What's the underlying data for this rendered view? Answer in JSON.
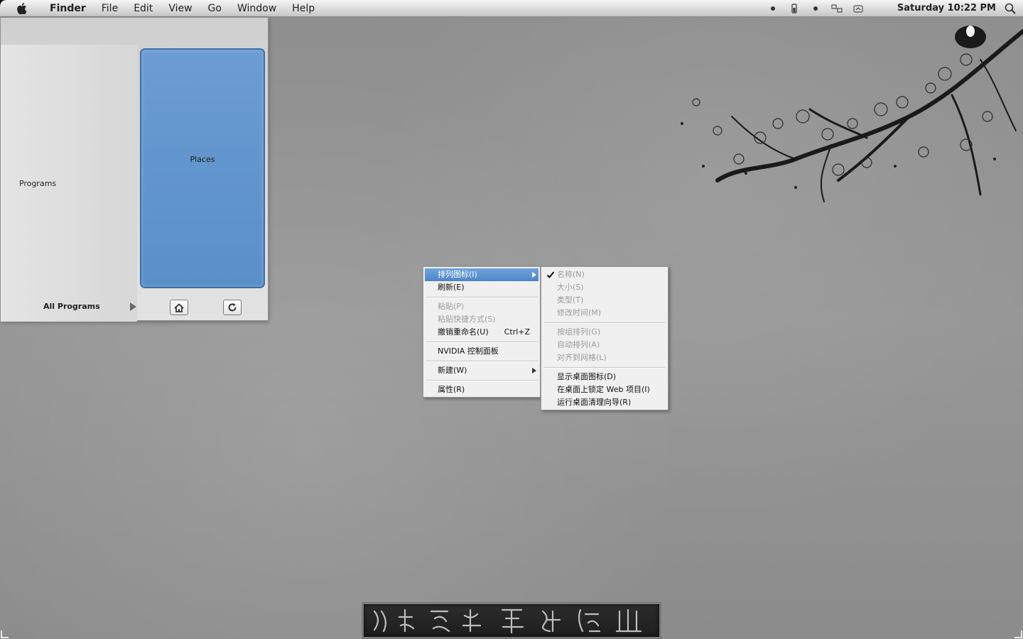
{
  "menubar": {
    "app_name": "Finder",
    "items": [
      "File",
      "Edit",
      "View",
      "Go",
      "Window",
      "Help"
    ],
    "clock": "Saturday 10:22 PM"
  },
  "start_panel": {
    "programs_label": "Programs",
    "all_programs_label": "All Programs",
    "places_label": "Places"
  },
  "context_menu": {
    "items": [
      {
        "label": "排列图标(I)"
      },
      {
        "label": "刷新(E)"
      },
      {
        "label": "粘贴(P)"
      },
      {
        "label": "粘贴快捷方式(S)"
      },
      {
        "label": "撤销重命名(U)",
        "shortcut": "Ctrl+Z"
      },
      {
        "label": "NVIDIA 控制面板"
      },
      {
        "label": "新建(W)"
      },
      {
        "label": "属性(R)"
      }
    ]
  },
  "submenu": {
    "items": [
      {
        "label": "名称(N)"
      },
      {
        "label": "大小(S)"
      },
      {
        "label": "类型(T)"
      },
      {
        "label": "修改时间(M)"
      },
      {
        "label": "按组排列(G)"
      },
      {
        "label": "自动排列(A)"
      },
      {
        "label": "对齐到网格(L)"
      },
      {
        "label": "显示桌面图标(D)"
      },
      {
        "label": "在桌面上锁定 Web 项目(I)"
      },
      {
        "label": "运行桌面清理向导(R)"
      }
    ]
  },
  "colors": {
    "places_blue": "#5a8fc9",
    "menu_highlight": "#4d86c6",
    "disabled_text": "#9b9b9b"
  }
}
